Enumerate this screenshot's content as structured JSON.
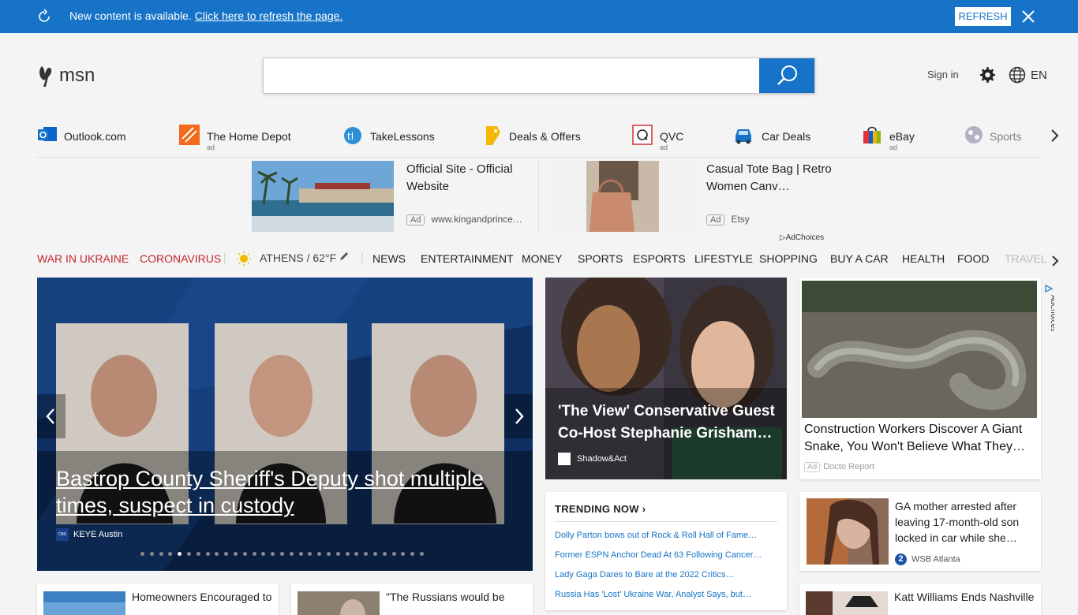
{
  "banner": {
    "message": "New content is available. ",
    "link": "Click here to refresh the page.",
    "button": "REFRESH"
  },
  "header": {
    "logo": "msn",
    "search_placeholder": "",
    "signin": "Sign in",
    "lang": "EN"
  },
  "quicklinks": [
    {
      "label": "Outlook.com",
      "ad": ""
    },
    {
      "label": "The Home Depot",
      "ad": "ad"
    },
    {
      "label": "TakeLessons",
      "ad": ""
    },
    {
      "label": "Deals & Offers",
      "ad": ""
    },
    {
      "label": "QVC",
      "ad": "ad"
    },
    {
      "label": "Car Deals",
      "ad": ""
    },
    {
      "label": "eBay",
      "ad": "ad"
    },
    {
      "label": "Sports",
      "ad": ""
    }
  ],
  "ads": [
    {
      "title": "Official Site - Official Website",
      "badge": "Ad",
      "source": "www.kingandprince…"
    },
    {
      "title": "Casual Tote Bag | Retro Women Canv…",
      "badge": "Ad",
      "source": "Etsy"
    }
  ],
  "adchoices": "AdChoices",
  "nav": {
    "items": [
      "WAR IN UKRAINE",
      "CORONAVIRUS",
      "ATHENS / 62°F",
      "NEWS",
      "ENTERTAINMENT",
      "MONEY",
      "SPORTS",
      "ESPORTS",
      "LIFESTYLE",
      "SHOPPING",
      "BUY A CAR",
      "HEALTH",
      "FOOD",
      "TRAVEL"
    ]
  },
  "hero": {
    "title": "Bastrop County Sheriff's Deputy shot multiple times, suspect in custody",
    "source": "KEYE Austin",
    "source_logo": "CBS AUSTIN",
    "slides": 31,
    "active": 4
  },
  "card2": {
    "title": "'The View' Conservative Guest Co-Host Stephanie Grisham…",
    "source": "Shadow&Act"
  },
  "card3": {
    "title": "Construction Workers Discover A Giant Snake, You Won't Believe What They…",
    "badge": "Ad",
    "source": "Docto Report"
  },
  "trending": {
    "heading": "TRENDING NOW ›",
    "items": [
      "Dolly Parton bows out of Rock & Roll Hall of Fame…",
      "Former ESPN Anchor Dead At 63 Following Cancer…",
      "Lady Gaga Dares to Bare at the 2022 Critics…",
      "Russia Has 'Lost' Ukraine War, Analyst Says, but…"
    ]
  },
  "card4": {
    "title": "GA mother arrested after leaving 17-month-old son locked in car while she…",
    "source": "WSB Atlanta",
    "source_logo": "2"
  },
  "bottom": [
    {
      "title": "Homeowners Encouraged to"
    },
    {
      "title": "\"The Russians would be"
    },
    {
      "title": "Katt Williams Ends Nashville"
    }
  ]
}
